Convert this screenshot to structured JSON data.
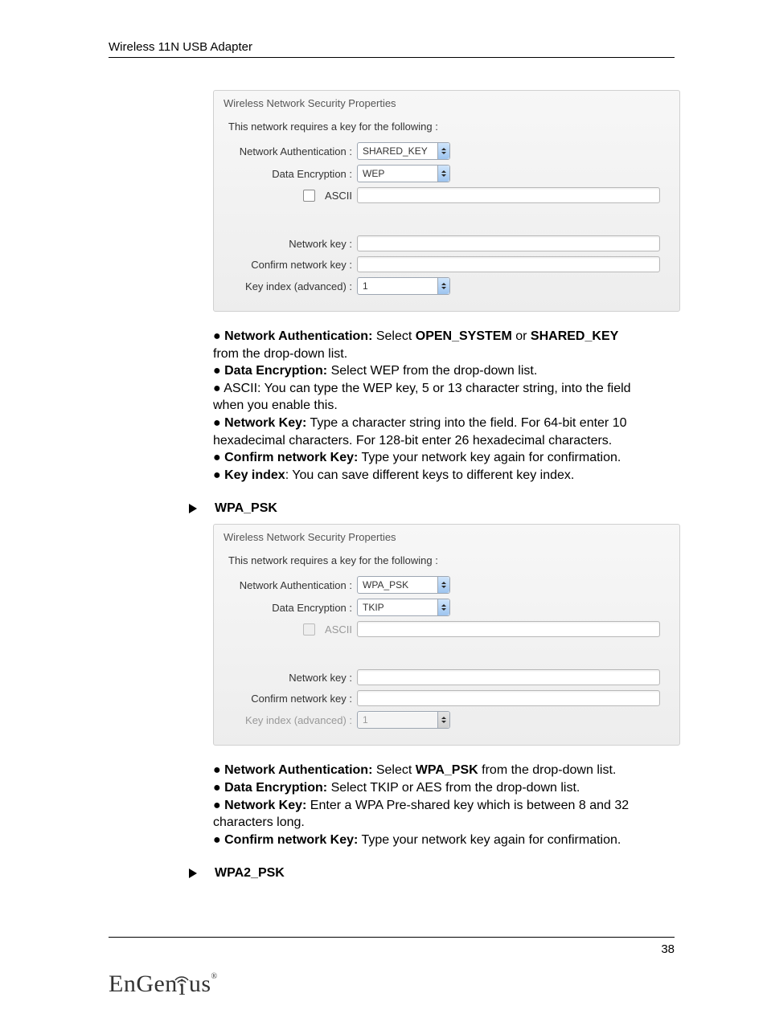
{
  "header": {
    "title": "Wireless 11N USB Adapter"
  },
  "panel1": {
    "title": "Wireless Network Security Properties",
    "intro": "This network requires a key for the following :",
    "labels": {
      "auth": "Network Authentication :",
      "enc": "Data Encryption :",
      "ascii": "ASCII",
      "key": "Network key :",
      "confirm": "Confirm network key :",
      "index": "Key index (advanced) :"
    },
    "values": {
      "auth": "SHARED_KEY",
      "enc": "WEP",
      "index": "1"
    }
  },
  "desc1": {
    "l1a": "● ",
    "l1b": "Network Authentication:",
    "l1c": " Select ",
    "l1d": "OPEN_SYSTEM",
    "l1e": " or ",
    "l1f": "SHARED_KEY",
    "l2": "from the drop-down list.",
    "l3a": "● ",
    "l3b": "Data Encryption:",
    "l3c": " Select WEP from the drop-down list.",
    "l4": "● ASCII: You can type the WEP key, 5 or 13 character string, into the field when you enable this.",
    "l5a": "● ",
    "l5b": "Network Key:",
    "l5c": " Type a character string into the field. For 64-bit enter 10 hexadecimal characters. For 128-bit enter 26 hexadecimal characters.",
    "l6a": "● ",
    "l6b": "Confirm network Key:",
    "l6c": " Type your network key again for confirmation.",
    "l7a": "● ",
    "l7b": "Key index",
    "l7c": ": You can save different keys to different key index."
  },
  "heading1": "WPA_PSK",
  "panel2": {
    "title": "Wireless Network Security Properties",
    "intro": "This network requires a key for the following :",
    "labels": {
      "auth": "Network Authentication :",
      "enc": "Data Encryption :",
      "ascii": "ASCII",
      "key": "Network key :",
      "confirm": "Confirm network key :",
      "index": "Key index (advanced) :"
    },
    "values": {
      "auth": "WPA_PSK",
      "enc": "TKIP",
      "index": "1"
    }
  },
  "desc2": {
    "l1a": "● ",
    "l1b": "Network Authentication:",
    "l1c": " Select ",
    "l1d": "WPA_PSK",
    "l1e": " from the drop-down list.",
    "l2a": "● ",
    "l2b": "Data Encryption:",
    "l2c": " Select TKIP or AES from the drop-down list.",
    "l3a": "● ",
    "l3b": "Network Key:",
    "l3c": " Enter a WPA Pre-shared key which is between 8 and 32 characters long.",
    "l4a": "● ",
    "l4b": "Confirm network Key:",
    "l4c": " Type your network key again for confirmation."
  },
  "heading2": "WPA2_PSK",
  "footer": {
    "page": "38",
    "logo_a": "EnGen",
    "logo_b": "us",
    "reg": "®"
  }
}
